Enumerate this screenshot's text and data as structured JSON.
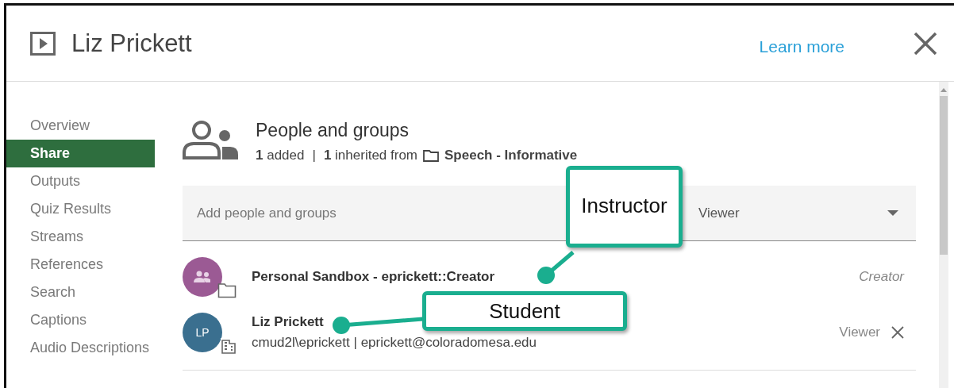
{
  "window": {
    "title": "Liz Prickett",
    "link": "Learn more"
  },
  "sidebar": {
    "items": [
      {
        "label": "Overview",
        "selected": false
      },
      {
        "label": "Share",
        "selected": true
      },
      {
        "label": "Outputs",
        "selected": false
      },
      {
        "label": "Quiz Results",
        "selected": false
      },
      {
        "label": "Streams",
        "selected": false
      },
      {
        "label": "References",
        "selected": false
      },
      {
        "label": "Search",
        "selected": false
      },
      {
        "label": "Captions",
        "selected": false
      },
      {
        "label": "Audio Descriptions",
        "selected": false
      }
    ]
  },
  "share": {
    "title": "People and groups",
    "added_count": "1",
    "added_label": "added",
    "separator": "|",
    "inherited_count": "1",
    "inherited_label": "inherited from",
    "source": "Speech - Informative",
    "add_field": {
      "placeholder": "Add people and groups",
      "role": "Viewer"
    },
    "members": [
      {
        "kind": "group",
        "color": "#9b5a94",
        "name": "Personal Sandbox - eprickett::Creator",
        "role": "Creator",
        "inherited": true
      },
      {
        "kind": "initials",
        "initials": "LP",
        "color": "#3a6f8f",
        "name": "Liz Prickett",
        "detail": "cmud2l\\eprickett | eprickett@coloradomesa.edu",
        "role": "Viewer",
        "inherited": false
      }
    ]
  },
  "callouts": [
    {
      "label": "Instructor"
    },
    {
      "label": "Student"
    }
  ]
}
